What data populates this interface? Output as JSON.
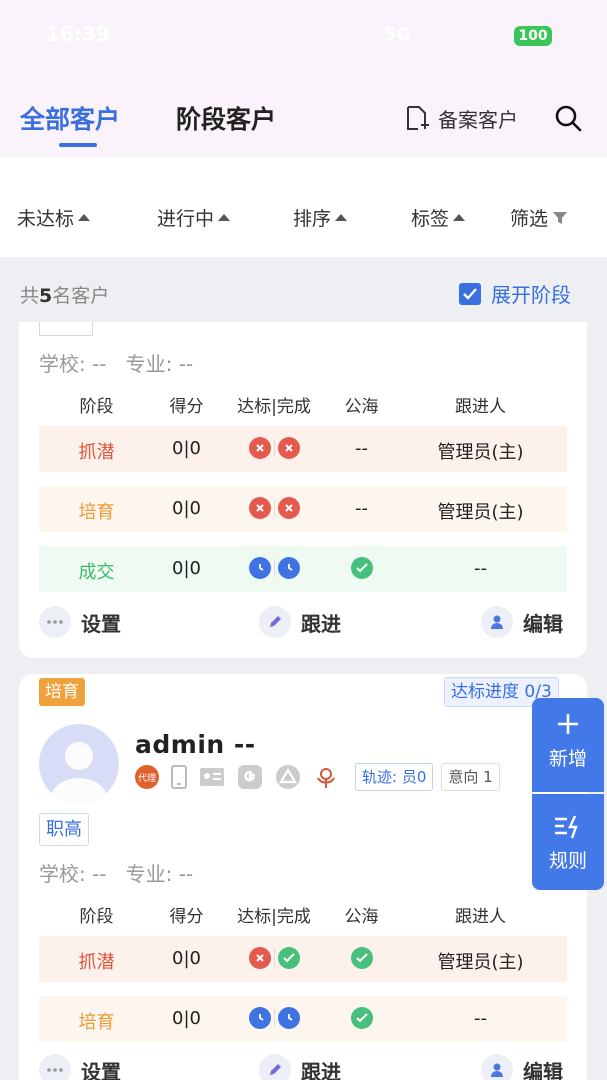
{
  "status_bar": {
    "time": "16:39",
    "network": "5G",
    "battery": "100"
  },
  "header": {
    "tabs": [
      {
        "label": "全部客户"
      },
      {
        "label": "阶段客户"
      }
    ],
    "record_label": "备案客户"
  },
  "filters": [
    "未达标",
    "进行中",
    "排序",
    "标签",
    "筛选"
  ],
  "summary": {
    "prefix": "共",
    "count": "5",
    "suffix": "名客户",
    "expand_label": "展开阶段"
  },
  "columns": [
    "阶段",
    "得分",
    "达标|完成",
    "公海",
    "跟进人"
  ],
  "school_label": "学校: --",
  "major_label": "专业: --",
  "actions": {
    "settings": "设置",
    "follow": "跟进",
    "edit": "编辑"
  },
  "card1": {
    "rows": [
      {
        "stage": "抓潜",
        "score": "0|0",
        "sea": "--",
        "owner": "管理员(主)"
      },
      {
        "stage": "培育",
        "score": "0|0",
        "sea": "--",
        "owner": "管理员(主)"
      },
      {
        "stage": "成交",
        "score": "0|0",
        "sea": "",
        "owner": "--"
      }
    ]
  },
  "card2": {
    "stage_badge": "培育",
    "progress": "达标进度 0/3",
    "name": "admin --",
    "agent_label": "代理",
    "track": "轨迹: 员0",
    "intent": "意向 1",
    "edu_tag": "职高",
    "rows": [
      {
        "stage": "抓潜",
        "score": "0|0",
        "owner": "管理员(主)"
      },
      {
        "stage": "培育",
        "score": "0|0",
        "owner": "--"
      }
    ]
  },
  "fab": {
    "add": "新增",
    "rule": "规则"
  },
  "colors": {
    "accent": "#3a6fe0",
    "red": "#e55a4e",
    "green": "#46c07a",
    "orange": "#efa23b"
  }
}
